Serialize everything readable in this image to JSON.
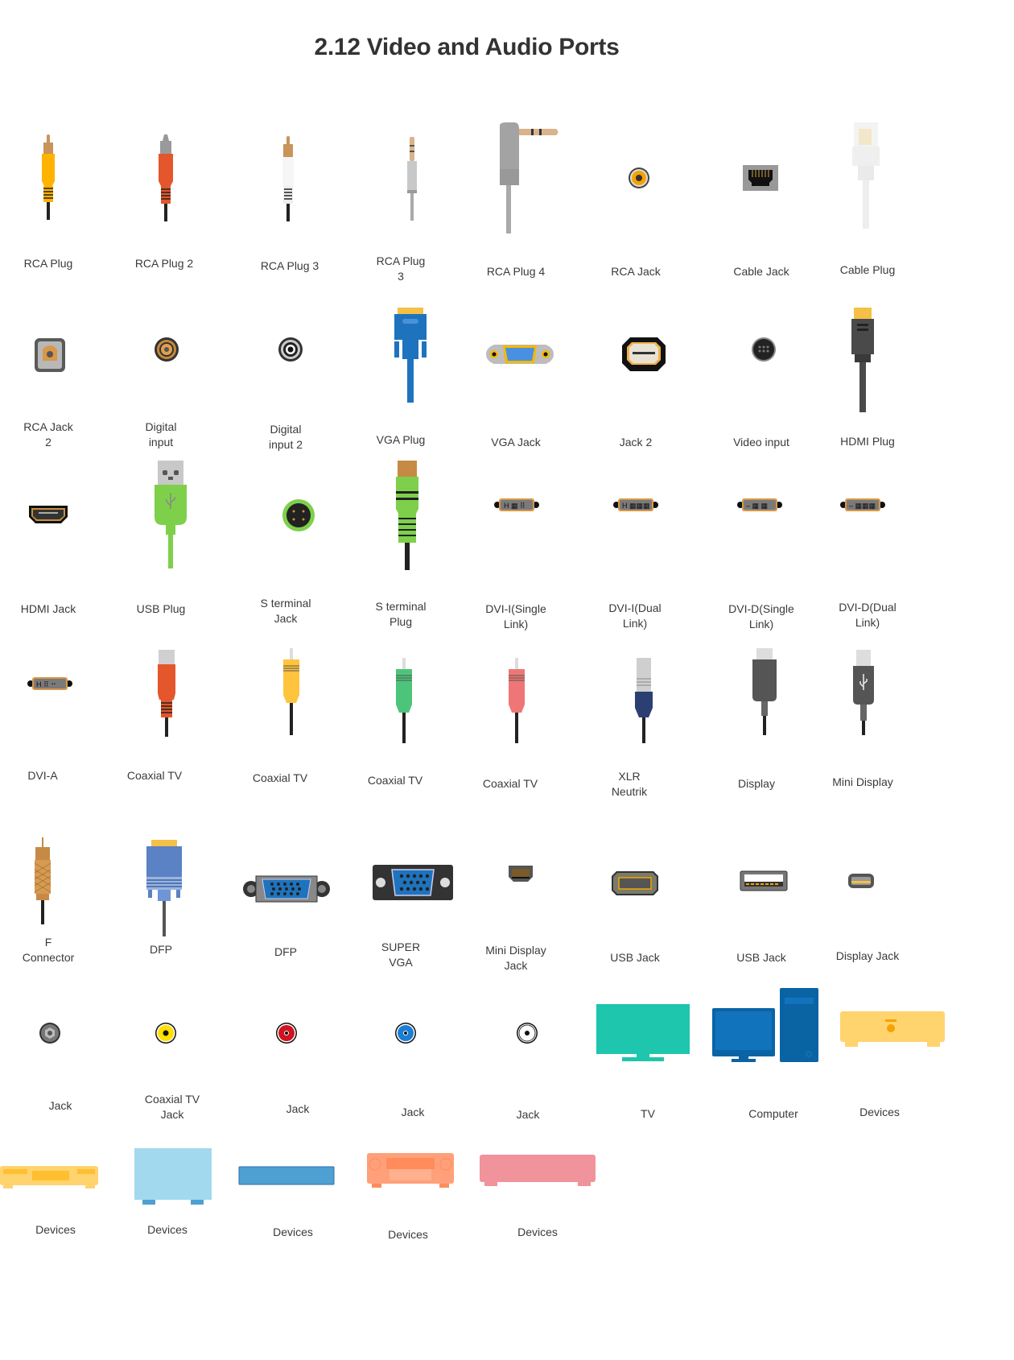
{
  "title": "2.12 Video and Audio Ports",
  "shapes": [
    {
      "id": "rca-plug",
      "label": "RCA Plug",
      "icon": "rca-plug-yellow-icon"
    },
    {
      "id": "rca-plug-2",
      "label": "RCA Plug 2",
      "icon": "rca-plug-red-icon"
    },
    {
      "id": "rca-plug-3",
      "label": "RCA Plug 3",
      "icon": "rca-plug-white-icon"
    },
    {
      "id": "rca-plug-3b",
      "label": "RCA Plug\n3",
      "icon": "audio-jack-straight-icon"
    },
    {
      "id": "rca-plug-4",
      "label": "RCA Plug 4",
      "icon": "audio-jack-angled-icon"
    },
    {
      "id": "rca-jack",
      "label": "RCA Jack",
      "icon": "rca-jack-icon"
    },
    {
      "id": "cable-jack",
      "label": "Cable Jack",
      "icon": "ethernet-jack-icon"
    },
    {
      "id": "cable-plug",
      "label": "Cable Plug",
      "icon": "ethernet-plug-icon"
    },
    {
      "id": "rca-jack-2",
      "label": "RCA Jack\n2",
      "icon": "optical-jack-icon"
    },
    {
      "id": "digital-input",
      "label": "Digital\ninput",
      "icon": "digital-input-jack-icon"
    },
    {
      "id": "digital-input-2",
      "label": "Digital\ninput 2",
      "icon": "digital-input-jack-2-icon"
    },
    {
      "id": "vga-plug",
      "label": "VGA Plug",
      "icon": "vga-plug-icon"
    },
    {
      "id": "vga-jack",
      "label": "VGA Jack",
      "icon": "vga-jack-icon"
    },
    {
      "id": "jack-2",
      "label": "Jack 2",
      "icon": "mini-din-jack-icon"
    },
    {
      "id": "video-input",
      "label": "Video input",
      "icon": "s-video-jack-icon"
    },
    {
      "id": "hdmi-plug",
      "label": "HDMI Plug",
      "icon": "hdmi-plug-icon"
    },
    {
      "id": "hdmi-jack",
      "label": "HDMI Jack",
      "icon": "hdmi-jack-icon"
    },
    {
      "id": "usb-plug",
      "label": "USB Plug",
      "icon": "usb-plug-icon"
    },
    {
      "id": "s-terminal-jack",
      "label": "S terminal\nJack",
      "icon": "s-terminal-jack-icon"
    },
    {
      "id": "s-terminal-plug",
      "label": "S terminal\nPlug",
      "icon": "s-terminal-plug-icon"
    },
    {
      "id": "dvi-i-single",
      "label": "DVI-I(Single\nLink)",
      "icon": "dvi-i-single-icon"
    },
    {
      "id": "dvi-i-dual",
      "label": "DVI-I(Dual\nLink)",
      "icon": "dvi-i-dual-icon"
    },
    {
      "id": "dvi-d-single",
      "label": "DVI-D(Single\nLink)",
      "icon": "dvi-d-single-icon"
    },
    {
      "id": "dvi-d-dual",
      "label": "DVI-D(Dual\nLink)",
      "icon": "dvi-d-dual-icon"
    },
    {
      "id": "dvi-a",
      "label": "DVI-A",
      "icon": "dvi-a-icon"
    },
    {
      "id": "coaxial-tv-1",
      "label": "Coaxial TV",
      "icon": "coax-plug-red-icon"
    },
    {
      "id": "coaxial-tv-2",
      "label": "Coaxial TV",
      "icon": "coax-plug-yellow-icon"
    },
    {
      "id": "coaxial-tv-3",
      "label": "Coaxial TV",
      "icon": "coax-plug-green-icon"
    },
    {
      "id": "coaxial-tv-4",
      "label": "Coaxial TV",
      "icon": "coax-plug-pink-icon"
    },
    {
      "id": "xlr-neutrik",
      "label": "XLR\nNeutrik",
      "icon": "xlr-plug-icon"
    },
    {
      "id": "display",
      "label": "Display",
      "icon": "display-plug-icon"
    },
    {
      "id": "mini-display",
      "label": "Mini Display",
      "icon": "mini-display-plug-icon"
    },
    {
      "id": "f-connector",
      "label": "F\nConnector",
      "icon": "f-connector-icon"
    },
    {
      "id": "dfp-1",
      "label": "DFP",
      "icon": "dfp-plug-icon"
    },
    {
      "id": "dfp-2",
      "label": "DFP",
      "icon": "dfp-jack-icon"
    },
    {
      "id": "super-vga",
      "label": "SUPER\nVGA",
      "icon": "super-vga-icon"
    },
    {
      "id": "mini-display-jack",
      "label": "Mini Display\nJack",
      "icon": "mini-display-jack-icon"
    },
    {
      "id": "usb-jack-1",
      "label": "USB Jack",
      "icon": "usb-jack-displayport-icon"
    },
    {
      "id": "usb-jack-2",
      "label": "USB Jack",
      "icon": "usb-a-jack-icon"
    },
    {
      "id": "display-jack",
      "label": "Display Jack",
      "icon": "mini-hdmi-jack-icon"
    },
    {
      "id": "jack-gray",
      "label": "Jack",
      "icon": "jack-gray-icon"
    },
    {
      "id": "coaxial-tv-jack",
      "label": "Coaxial TV\nJack",
      "icon": "jack-yellow-icon"
    },
    {
      "id": "jack-red",
      "label": "Jack",
      "icon": "jack-red-icon"
    },
    {
      "id": "jack-blue",
      "label": "Jack",
      "icon": "jack-blue-icon"
    },
    {
      "id": "jack-white",
      "label": "Jack",
      "icon": "jack-white-icon"
    },
    {
      "id": "tv",
      "label": "TV",
      "icon": "tv-icon"
    },
    {
      "id": "computer",
      "label": "Computer",
      "icon": "computer-icon"
    },
    {
      "id": "devices-1",
      "label": "Devices",
      "icon": "device-yellow-box-icon"
    },
    {
      "id": "devices-2",
      "label": "Devices",
      "icon": "device-yellow-dvd-icon"
    },
    {
      "id": "devices-3",
      "label": "Devices",
      "icon": "device-lightblue-icon"
    },
    {
      "id": "devices-4",
      "label": "Devices",
      "icon": "device-blue-slim-icon"
    },
    {
      "id": "devices-5",
      "label": "Devices",
      "icon": "device-orange-receiver-icon"
    },
    {
      "id": "devices-6",
      "label": "Devices",
      "icon": "device-pink-icon"
    }
  ]
}
